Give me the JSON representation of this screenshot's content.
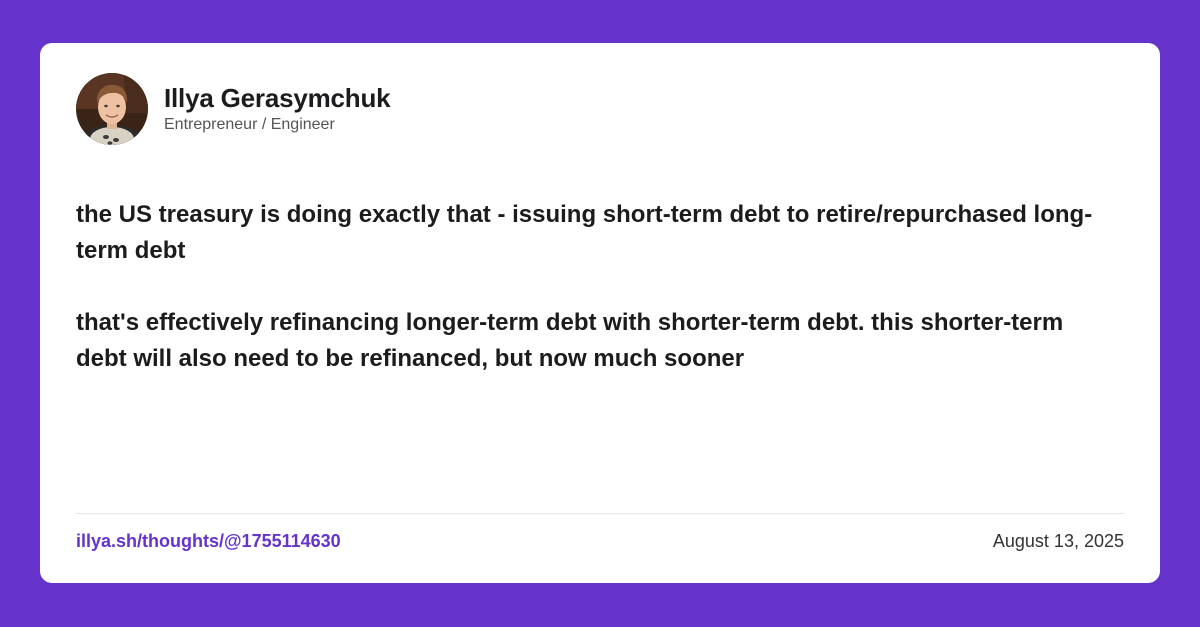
{
  "colors": {
    "background": "#6633cc",
    "card": "#ffffff",
    "link": "#6633cc",
    "text": "#1c1c1e"
  },
  "author": {
    "name": "Illya Gerasymchuk",
    "title": "Entrepreneur / Engineer",
    "avatar_icon": "profile-photo"
  },
  "post": {
    "paragraphs": [
      "the US treasury is doing exactly that - issuing short-term debt to retire/repurchased long-term debt",
      "that's effectively refinancing longer-term debt with shorter-term debt. this shorter-term debt will also need to be refinanced, but now much sooner"
    ]
  },
  "footer": {
    "link_text": "illya.sh/thoughts/@1755114630",
    "date": "August 13, 2025"
  }
}
